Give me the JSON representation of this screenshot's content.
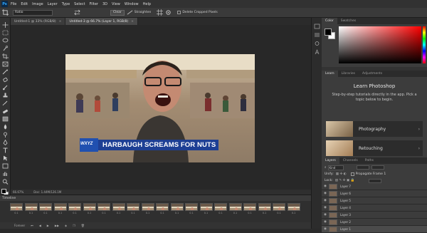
{
  "menubar": {
    "logo": "Ps",
    "items": [
      "File",
      "Edit",
      "Image",
      "Layer",
      "Type",
      "Select",
      "Filter",
      "3D",
      "View",
      "Window",
      "Help"
    ]
  },
  "options": {
    "style_label": "",
    "mode_value": "Ratio",
    "clear_label": "Clear",
    "straighten_label": "Straighten",
    "delete_cropped_label": "Delete Cropped Pixels"
  },
  "tabs": [
    {
      "label": "Untitled-1 @ 33% (RGB/8)",
      "active": false
    },
    {
      "label": "Untitled-3 @ 66.7% (Layer 1, RGB/8)",
      "active": true
    }
  ],
  "photo": {
    "caption": "HARBAUGH SCREAMS FOR NUTS",
    "logo_text": "WXYZ"
  },
  "status": {
    "zoom": "66.67%",
    "doc_info": "Doc: 1.44M/126.1M"
  },
  "timeline": {
    "title": "Timeline",
    "frames": [
      "0.1",
      "0.1",
      "0.1",
      "0.1",
      "0.1",
      "0.1",
      "0.1",
      "0.1",
      "0.1",
      "0.1",
      "0.1",
      "0.1",
      "0.1",
      "0.1",
      "0.1",
      "0.1",
      "0.1",
      "0.1",
      "0.1",
      "0.1"
    ],
    "loop_label": "Forever"
  },
  "color_panel": {
    "tabs": [
      "Color",
      "Swatches"
    ]
  },
  "learn_panel": {
    "tabs": [
      "Learn",
      "Libraries",
      "Adjustments"
    ],
    "title": "Learn Photoshop",
    "description": "Step-by-step tutorials directly in the app. Pick a topic below to begin.",
    "cards": [
      {
        "label": "Photography"
      },
      {
        "label": "Retouching"
      }
    ]
  },
  "layers_panel": {
    "tabs": [
      "Layers",
      "Channels",
      "Paths"
    ],
    "kind_label": "Kind",
    "unify_label": "Unify:",
    "propagate_label": "Propagate Frame 1",
    "lock_label": "Lock:",
    "layers": [
      {
        "name": "Layer 7",
        "selected": false
      },
      {
        "name": "Layer 6",
        "selected": false
      },
      {
        "name": "Layer 5",
        "selected": false
      },
      {
        "name": "Layer 4",
        "selected": false
      },
      {
        "name": "Layer 3",
        "selected": false
      },
      {
        "name": "Layer 2",
        "selected": false
      },
      {
        "name": "Layer 1",
        "selected": true
      }
    ]
  }
}
